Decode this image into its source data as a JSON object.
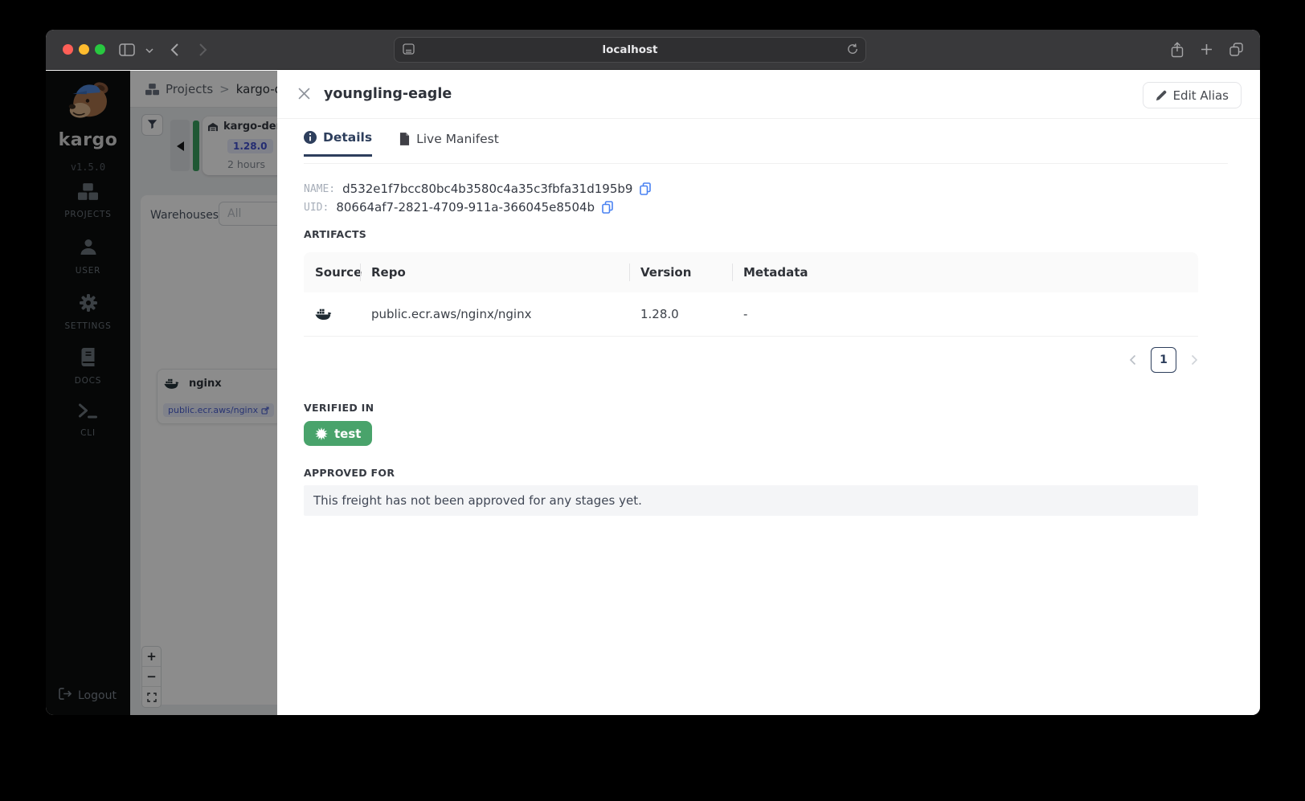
{
  "browser": {
    "url": "localhost"
  },
  "sidebar": {
    "logo_text": "kargo",
    "version": "v1.5.0",
    "items": [
      {
        "label": "PROJECTS",
        "icon": "boxes-icon"
      },
      {
        "label": "USER",
        "icon": "user-icon"
      },
      {
        "label": "SETTINGS",
        "icon": "gear-icon"
      },
      {
        "label": "DOCS",
        "icon": "book-icon"
      },
      {
        "label": "CLI",
        "icon": "terminal-icon"
      }
    ],
    "logout_label": "Logout"
  },
  "background": {
    "breadcrumb": {
      "root": "Projects",
      "separator": ">",
      "current": "kargo-demo"
    },
    "pipeline": {
      "warehouse_name": "kargo-demo",
      "freight_version": "1.28.0",
      "freight_age": "2 hours"
    },
    "warehouses_filter": {
      "label": "Warehouses:",
      "value": "All"
    },
    "repo_card": {
      "title": "nginx",
      "repo_tag": "public.ecr.aws/nginx"
    },
    "zoom_controls": {
      "zoom_in": "+",
      "zoom_out": "−"
    }
  },
  "drawer": {
    "title": "youngling-eagle",
    "edit_alias_label": "Edit Alias",
    "tabs": {
      "details": "Details",
      "live_manifest": "Live Manifest"
    },
    "fields": {
      "name_label": "NAME:",
      "name_value": "d532e1f7bcc80bc4b3580c4a35c3fbfa31d195b9",
      "uid_label": "UID:",
      "uid_value": "80664af7-2821-4709-911a-366045e8504b"
    },
    "artifacts": {
      "heading": "ARTIFACTS",
      "columns": [
        "Source",
        "Repo",
        "Version",
        "Metadata"
      ],
      "rows": [
        {
          "source_icon": "docker-icon",
          "repo": "public.ecr.aws/nginx/nginx",
          "version": "1.28.0",
          "metadata": "-"
        }
      ]
    },
    "pagination": {
      "current_page": "1"
    },
    "verified_in": {
      "heading": "VERIFIED IN",
      "stages": [
        {
          "name": "test",
          "color": "#49a36b"
        }
      ]
    },
    "approved_for": {
      "heading": "APPROVED FOR",
      "empty_message": "This freight has not been approved for any stages yet."
    }
  },
  "colors": {
    "accent_navy": "#2d3e5c",
    "link_blue": "#4a82f2",
    "stage_green": "#49a36b",
    "freight_bar_green": "#3aa15f"
  }
}
